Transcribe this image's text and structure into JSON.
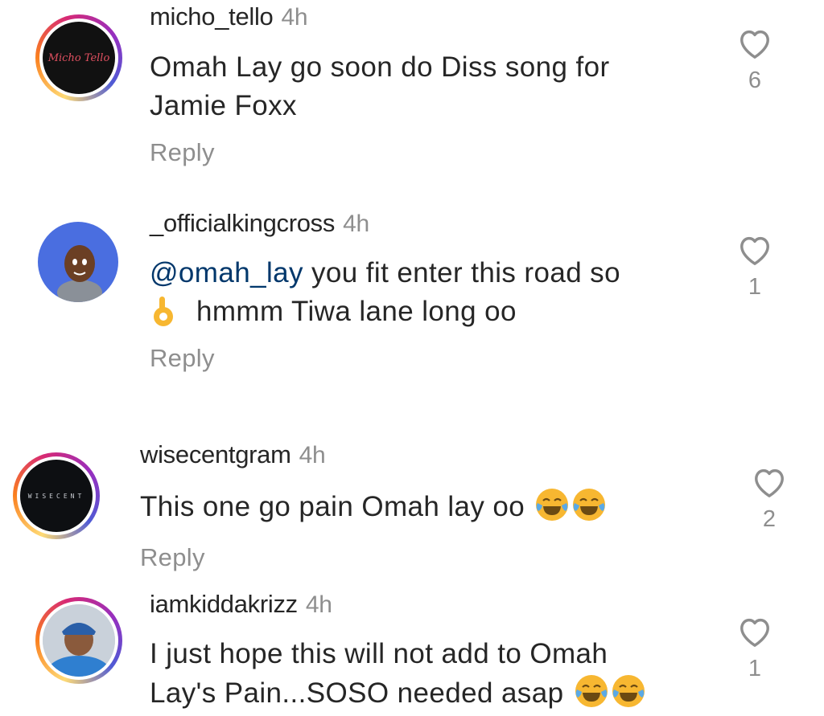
{
  "comments": [
    {
      "username": "micho_tello",
      "time": "4h",
      "avatar_text": "Micho Tello",
      "line1": "Omah Lay go soon do Diss song for",
      "line2": "Jamie Foxx",
      "reply": "Reply",
      "likes": "6"
    },
    {
      "username": "_officialkingcross",
      "time": "4h",
      "mention": "@omah_lay",
      "line1_rest": " you fit enter this road so",
      "line2": "hmmm Tiwa lane long oo",
      "reply": "Reply",
      "likes": "1"
    },
    {
      "username": "wisecentgram",
      "time": "4h",
      "avatar_text": "WISECENT",
      "line1": "This one go pain Omah lay oo",
      "reply": "Reply",
      "likes": "2"
    },
    {
      "username": "iamkiddakrizz",
      "time": "4h",
      "line1": "I just hope this will not add to Omah",
      "line2": "Lay's Pain...SOSO needed asap",
      "likes": "1"
    }
  ],
  "icons": {
    "heart": "heart-outline-icon",
    "laugh": "face-with-tears-of-joy-emoji",
    "ok": "ok-hand-emoji"
  },
  "colors": {
    "text": "#262626",
    "secondary": "#8e8e8e",
    "mention": "#00376b",
    "emoji_yellow": "#f7b731"
  }
}
